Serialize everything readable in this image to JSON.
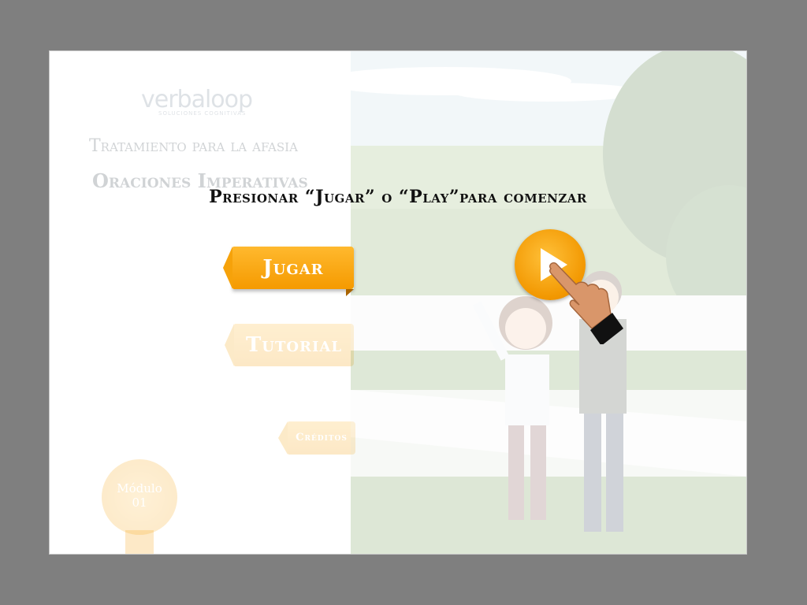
{
  "menu": {
    "logo_text": "verbaloop",
    "logo_subtitle": "SOLUCIONES COGNITIVAS",
    "title": "Tratamiento para la afasia",
    "subtitle": "Oraciones Imperativas",
    "buttons": {
      "jugar": "Jugar",
      "tutorial": "Tutorial",
      "creditos": "Créditos"
    },
    "modulo_label": "Módulo",
    "modulo_number": "01"
  },
  "overlay": {
    "instruction": "Presionar “Jugar” o “Play”para comenzar"
  },
  "icons": {
    "play": "play-icon",
    "hand": "pointing-hand-icon"
  },
  "colors": {
    "accent": "#f59a00",
    "background": "#7f7f7f",
    "text": "#111111"
  }
}
